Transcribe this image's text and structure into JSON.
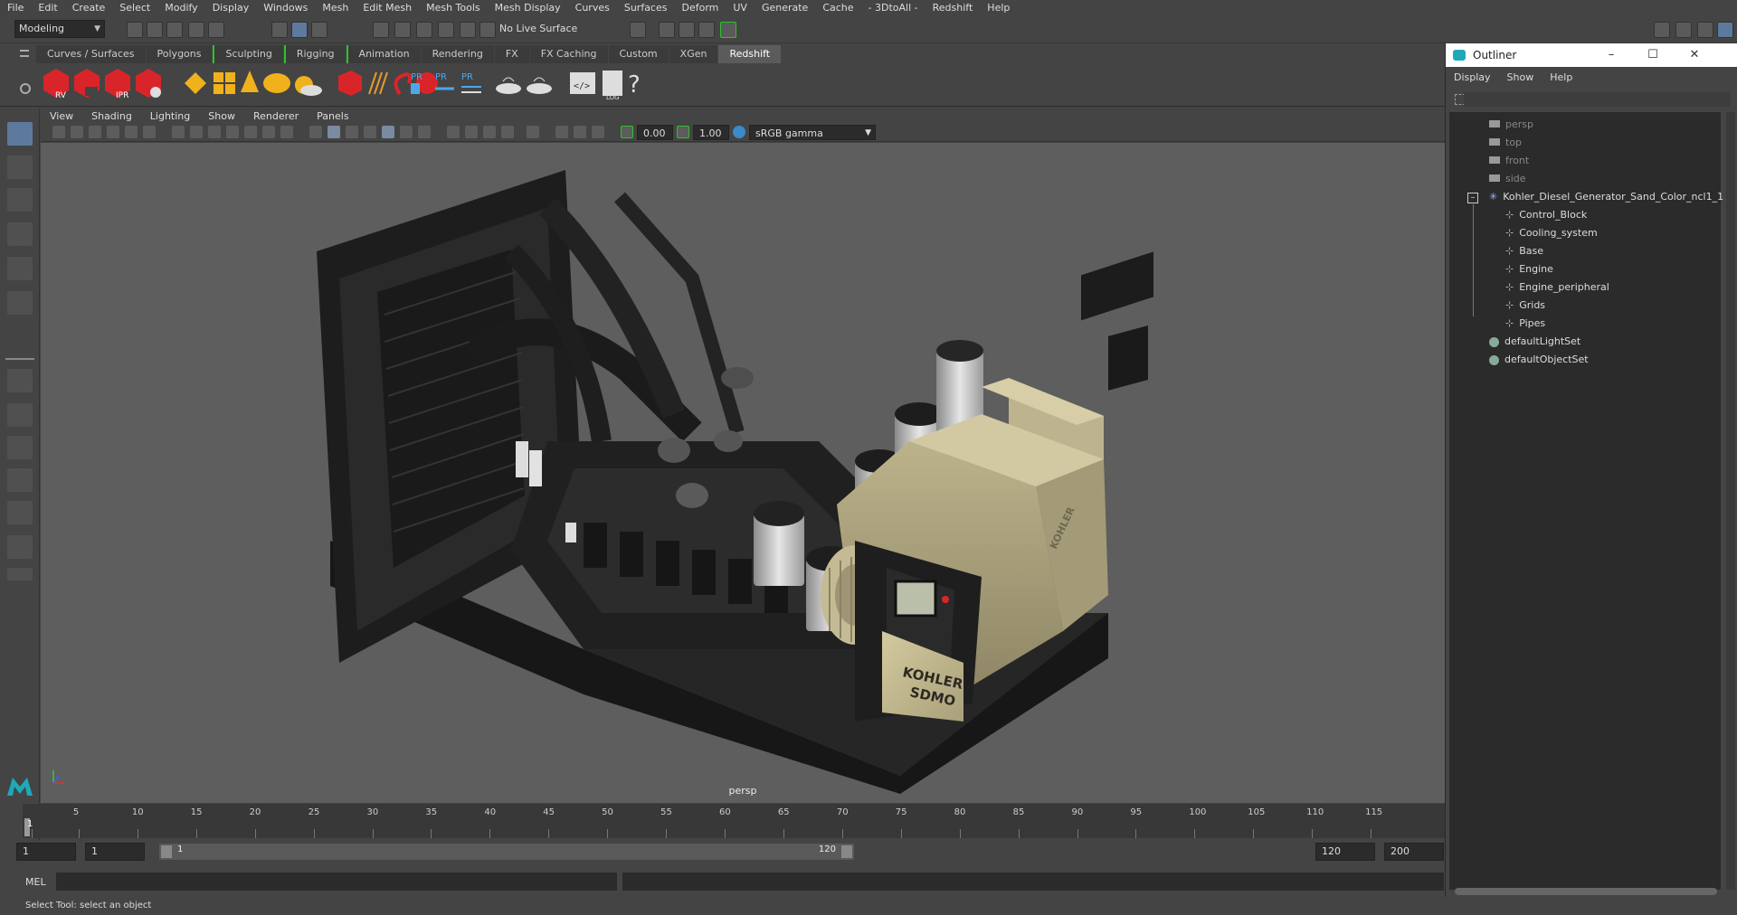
{
  "menubar": [
    "File",
    "Edit",
    "Create",
    "Select",
    "Modify",
    "Display",
    "Windows",
    "Mesh",
    "Edit Mesh",
    "Mesh Tools",
    "Mesh Display",
    "Curves",
    "Surfaces",
    "Deform",
    "UV",
    "Generate",
    "Cache",
    "- 3DtoAll -",
    "Redshift",
    "Help"
  ],
  "status": {
    "mode": "Modeling",
    "live_surface": "No Live Surface"
  },
  "shelf_tabs": [
    "Curves / Surfaces",
    "Polygons",
    "Sculpting",
    "Rigging",
    "Animation",
    "Rendering",
    "FX",
    "FX Caching",
    "Custom",
    "XGen",
    "Redshift"
  ],
  "active_shelf": "Redshift",
  "shelf_icons": [
    "RV",
    "",
    "IPR",
    "",
    "",
    "",
    "",
    "",
    "",
    "",
    "",
    "",
    "",
    "PR",
    "PR",
    "PR",
    "",
    "",
    "",
    "LOG",
    "?"
  ],
  "viewport": {
    "menu": [
      "View",
      "Shading",
      "Lighting",
      "Show",
      "Renderer",
      "Panels"
    ],
    "exposure": "0.00",
    "gamma": "1.00",
    "color_space": "sRGB gamma",
    "camera": "persp"
  },
  "timeline": {
    "ticks": [
      "1",
      "5",
      "10",
      "15",
      "20",
      "25",
      "30",
      "35",
      "40",
      "45",
      "50",
      "55",
      "60",
      "65",
      "70",
      "75",
      "80",
      "85",
      "90",
      "95",
      "100",
      "105",
      "110",
      "115"
    ],
    "current": "1"
  },
  "range": {
    "start": "1",
    "anim_start": "1",
    "slider_start": "1",
    "slider_end": "120",
    "end": "120",
    "anim_end": "200"
  },
  "cmdline": {
    "label": "MEL"
  },
  "helpline": "Select Tool: select an object",
  "outliner": {
    "title": "Outliner",
    "menu": [
      "Display",
      "Show",
      "Help"
    ],
    "cameras": [
      "persp",
      "top",
      "front",
      "side"
    ],
    "root": "Kohler_Diesel_Generator_Sand_Color_ncl1_1",
    "children": [
      "Control_Block",
      "Cooling_system",
      "Base",
      "Engine",
      "Engine_peripheral",
      "Grids",
      "Pipes"
    ],
    "sets": [
      "defaultLightSet",
      "defaultObjectSet"
    ]
  },
  "generator": {
    "brand_top": "KOHLER",
    "brand_bottom": "SDMO",
    "side_brand": "KOHLER"
  },
  "colors": {
    "accent_green": "#2ec12e",
    "redshift_red": "#d9252a",
    "sand": "#c9bf98",
    "frame": "#1f1f1f",
    "viewport_bg": "#5e5e5e"
  }
}
